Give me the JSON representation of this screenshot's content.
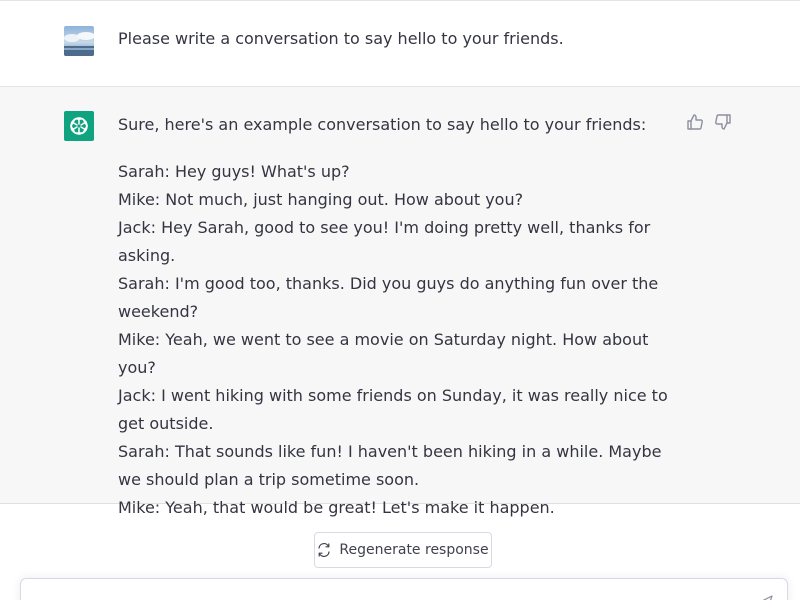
{
  "user_message": {
    "text": "Please write a conversation to say hello to your friends."
  },
  "assistant_message": {
    "intro": "Sure, here's an example conversation to say hello to your friends:",
    "lines": [
      "Sarah: Hey guys! What's up?",
      "Mike: Not much, just hanging out. How about you?",
      "Jack: Hey Sarah, good to see you! I'm doing pretty well, thanks for asking.",
      "Sarah: I'm good too, thanks. Did you guys do anything fun over the weekend?",
      "Mike: Yeah, we went to see a movie on Saturday night. How about you?",
      "Jack: I went hiking with some friends on Sunday, it was really nice to get outside.",
      "Sarah: That sounds like fun! I haven't been hiking in a while. Maybe we should plan a trip sometime soon.",
      "Mike: Yeah, that would be great! Let's make it happen."
    ]
  },
  "actions": {
    "regenerate_label": "Regenerate response"
  },
  "icons": {
    "user_avatar": "user-avatar-image",
    "assistant_avatar": "openai-logo-icon",
    "thumbs_up": "thumbs-up-icon",
    "thumbs_down": "thumbs-down-icon",
    "regenerate": "refresh-icon",
    "send": "send-icon"
  },
  "colors": {
    "assistant_avatar_bg": "#10a37f",
    "assistant_row_bg": "#f7f7f8",
    "text": "#343541"
  }
}
